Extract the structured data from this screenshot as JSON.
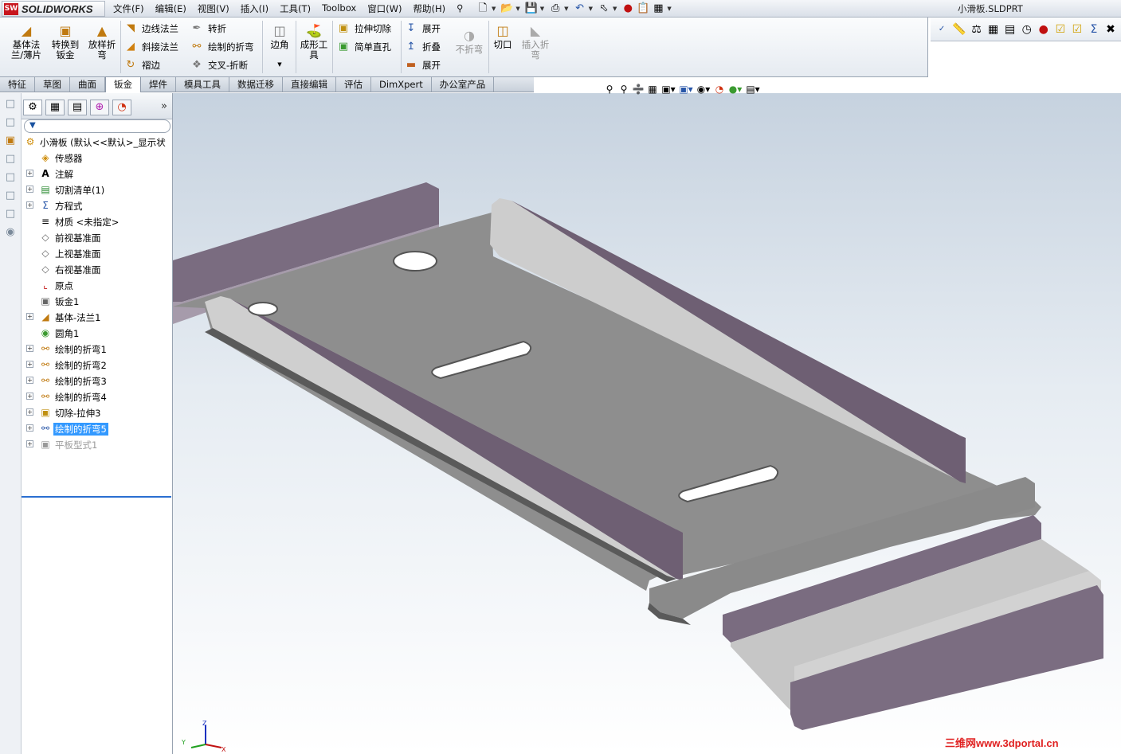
{
  "app": {
    "logo_text": "SOLIDWORKS",
    "logo_badge": "SW",
    "document_title": "小滑板.SLDPRT"
  },
  "menu": [
    "文件(F)",
    "编辑(E)",
    "视图(V)",
    "插入(I)",
    "工具(T)",
    "Toolbox",
    "窗口(W)",
    "帮助(H)"
  ],
  "command_manager": {
    "base_flange": "基体法兰/薄片",
    "convert_to_sheet_metal": "转换到钣金",
    "lofted_bend": "放样折弯",
    "edge_flange": "边线法兰",
    "miter_flange": "斜接法兰",
    "hem": "褶边",
    "jog": "转折",
    "sketched_bend": "绘制的折弯",
    "cross_break": "交叉-折断",
    "corners": "边角",
    "forming_tool": "成形工具",
    "extruded_cut": "拉伸切除",
    "simple_hole": "简单直孔",
    "unfold": "展开",
    "fold": "折叠",
    "flatten": "展开",
    "no_bends": "不折弯",
    "rip": "切口",
    "insert_bends": "插入折弯"
  },
  "tabs": [
    "特征",
    "草图",
    "曲面",
    "钣金",
    "焊件",
    "模具工具",
    "数据迁移",
    "直接编辑",
    "评估",
    "DimXpert",
    "办公室产品"
  ],
  "active_tab": "钣金",
  "feature_tree": {
    "root": "小滑板 (默认<<默认>_显示状",
    "items": [
      {
        "label": "传感器",
        "icon": "sensor-icon",
        "expandable": false
      },
      {
        "label": "注解",
        "icon": "annotation-icon",
        "expandable": true
      },
      {
        "label": "切割清单(1)",
        "icon": "cut-list-icon",
        "expandable": true
      },
      {
        "label": "方程式",
        "icon": "equation-icon",
        "expandable": true
      },
      {
        "label": "材质 <未指定>",
        "icon": "material-icon",
        "expandable": false
      },
      {
        "label": "前视基准面",
        "icon": "plane-icon",
        "expandable": false
      },
      {
        "label": "上视基准面",
        "icon": "plane-icon",
        "expandable": false
      },
      {
        "label": "右视基准面",
        "icon": "plane-icon",
        "expandable": false
      },
      {
        "label": "原点",
        "icon": "origin-icon",
        "expandable": false
      },
      {
        "label": "钣金1",
        "icon": "sheet-metal-icon",
        "expandable": false
      },
      {
        "label": "基体-法兰1",
        "icon": "base-flange-icon",
        "expandable": true
      },
      {
        "label": "圆角1",
        "icon": "fillet-icon",
        "expandable": false
      },
      {
        "label": "绘制的折弯1",
        "icon": "sketched-bend-icon",
        "expandable": true
      },
      {
        "label": "绘制的折弯2",
        "icon": "sketched-bend-icon",
        "expandable": true
      },
      {
        "label": "绘制的折弯3",
        "icon": "sketched-bend-icon",
        "expandable": true
      },
      {
        "label": "绘制的折弯4",
        "icon": "sketched-bend-icon",
        "expandable": true
      },
      {
        "label": "切除-拉伸3",
        "icon": "cut-extrude-icon",
        "expandable": true
      },
      {
        "label": "绘制的折弯5",
        "icon": "sketched-bend-icon",
        "expandable": true,
        "selected": true
      },
      {
        "label": "平板型式1",
        "icon": "flat-pattern-icon",
        "expandable": true,
        "suppressed": true
      }
    ]
  },
  "watermark": "三维网www.3dportal.cn",
  "colors": {
    "selection": "#3399ff",
    "sheet_top": "#8c8c8c",
    "flange_inner": "#cfcfcf",
    "edge_dark": "#6e5f73"
  }
}
